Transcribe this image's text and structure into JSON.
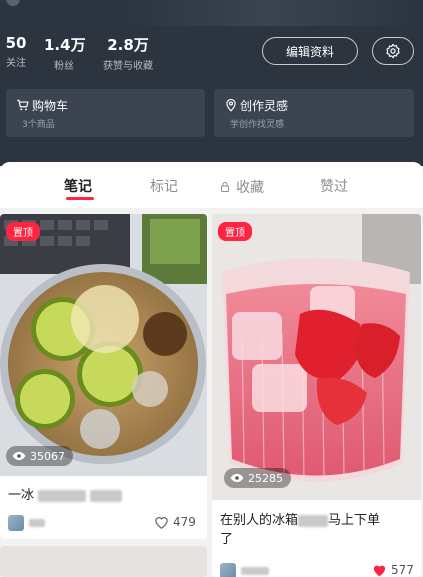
{
  "profile": {
    "stats": [
      {
        "value": "50",
        "label": "关注"
      },
      {
        "value": "1.4万",
        "label": "粉丝"
      },
      {
        "value": "2.8万",
        "label": "获赞与收藏"
      }
    ],
    "edit_label": "编辑资料"
  },
  "cards": [
    {
      "title": "购物车",
      "subtitle": "3个商品"
    },
    {
      "title": "创作灵感",
      "subtitle": "学创作找灵感"
    }
  ],
  "tabs": [
    "笔记",
    "标记",
    "收藏",
    "赞过"
  ],
  "active_tab": "笔记",
  "posts": [
    {
      "pin": "置顶",
      "views": "35067",
      "title": "一冰",
      "likes": "479"
    },
    {
      "pin": "置顶",
      "views": "25285",
      "title": "在别人的冰箱",
      "title_tail": "马上下单",
      "title_line2": "了",
      "likes": "577"
    }
  ],
  "colors": {
    "accent": "#ff2442",
    "header_bg": "#2c3440"
  }
}
